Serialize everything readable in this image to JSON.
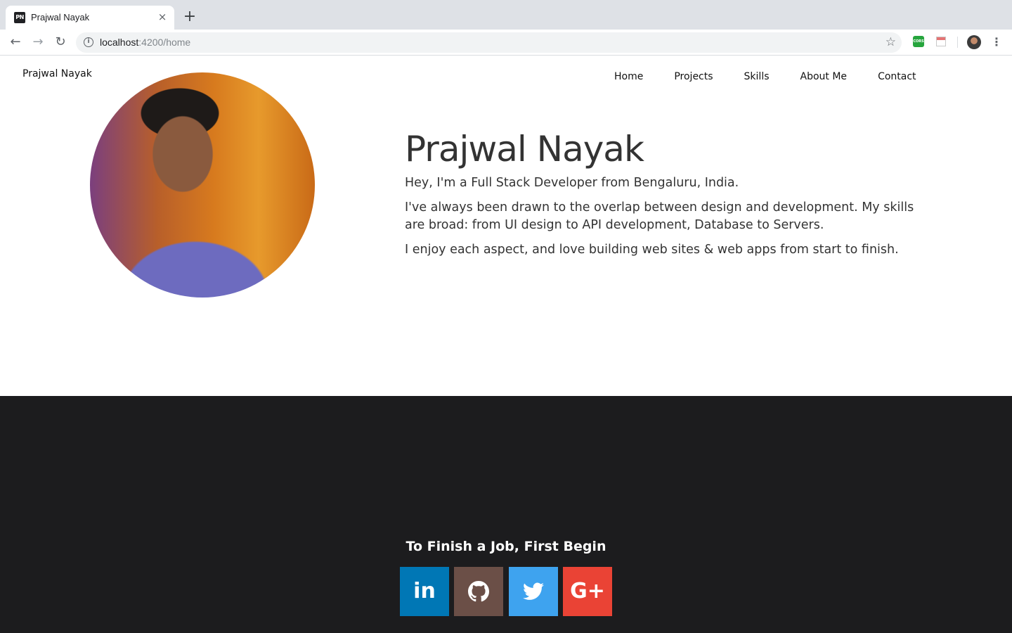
{
  "browser": {
    "tab_title": "Prajwal Nayak",
    "favicon_text": "PN",
    "close_glyph": "×",
    "new_tab_glyph": "+",
    "url_host": "localhost",
    "url_path": ":4200/home",
    "back_glyph": "←",
    "forward_glyph": "→",
    "reload_glyph": "↻",
    "bookmark_glyph": "☆",
    "menu_glyph": "⋮",
    "info_glyph": "i",
    "ext_cors_text": "CORS"
  },
  "site": {
    "brand": "Prajwal Nayak",
    "nav": [
      "Home",
      "Projects",
      "Skills",
      "About Me",
      "Contact"
    ]
  },
  "hero": {
    "portrait_alt": "Prajwal Nayak",
    "title": "Prajwal Nayak",
    "intro": "Hey, I'm a Full Stack Developer from Bengaluru, India.",
    "paragraph2": "I've always been drawn to the overlap between design and development. My skills are broad: from UI design to API development, Database to Servers.",
    "paragraph3": "I enjoy each aspect, and love building web sites & web apps from start to finish."
  },
  "footer": {
    "tagline": "To Finish a Job, First Begin",
    "social": [
      {
        "name": "linkedin-icon",
        "glyph": "in",
        "color": "#0077b5"
      },
      {
        "name": "github-icon",
        "glyph": "",
        "color": "#6b4f47"
      },
      {
        "name": "twitter-icon",
        "glyph": "",
        "color": "#3ea3ef"
      },
      {
        "name": "google-plus-icon",
        "glyph": "G+",
        "color": "#ea4335"
      }
    ]
  }
}
